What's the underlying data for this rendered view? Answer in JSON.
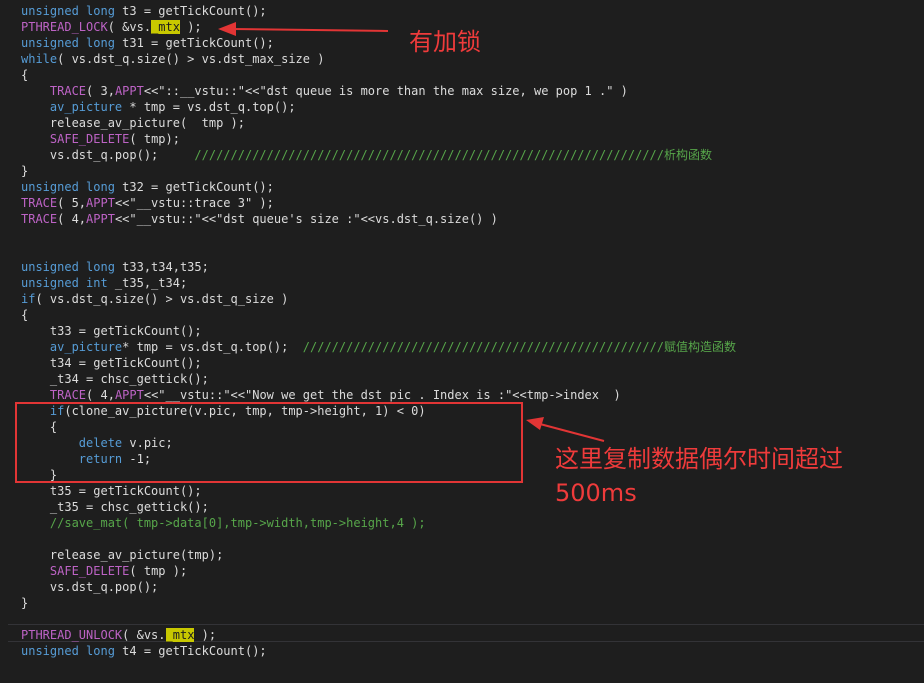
{
  "lines": [
    {
      "parts": [
        [
          "kw",
          "unsigned long"
        ],
        [
          "t",
          " t3 = getTickCount();"
        ]
      ]
    },
    {
      "parts": [
        [
          "mac",
          "PTHREAD_LOCK"
        ],
        [
          "t",
          "( &vs."
        ],
        [
          "hl",
          "_mtx"
        ],
        [
          "t",
          " );"
        ]
      ]
    },
    {
      "parts": [
        [
          "kw",
          "unsigned long"
        ],
        [
          "t",
          " t31 = getTickCount();"
        ]
      ]
    },
    {
      "parts": [
        [
          "kw",
          "while"
        ],
        [
          "t",
          "( vs.dst_q.size() > vs.dst_max_size )"
        ]
      ]
    },
    {
      "parts": [
        [
          "t",
          "{"
        ]
      ]
    },
    {
      "parts": [
        [
          "t",
          "    "
        ],
        [
          "mac",
          "TRACE"
        ],
        [
          "t",
          "( 3,"
        ],
        [
          "mac",
          "APPT"
        ],
        [
          "t",
          "<<\"::__vstu::\"<<\"dst queue is more than the max size, we pop 1 .\" )"
        ]
      ]
    },
    {
      "parts": [
        [
          "t",
          "    "
        ],
        [
          "kw",
          "av_picture"
        ],
        [
          "t",
          " * tmp = vs.dst_q.top();"
        ]
      ]
    },
    {
      "parts": [
        [
          "t",
          "    release_av_picture(  tmp );"
        ]
      ]
    },
    {
      "parts": [
        [
          "t",
          "    "
        ],
        [
          "mac",
          "SAFE_DELETE"
        ],
        [
          "t",
          "( tmp);"
        ]
      ]
    },
    {
      "parts": [
        [
          "t",
          "    vs.dst_q.pop();     "
        ],
        [
          "cm",
          "/////////////////////////////////////////////////////////////////析构函数"
        ]
      ]
    },
    {
      "parts": [
        [
          "t",
          "}"
        ]
      ]
    },
    {
      "parts": [
        [
          "kw",
          "unsigned long"
        ],
        [
          "t",
          " t32 = getTickCount();"
        ]
      ]
    },
    {
      "parts": [
        [
          "mac",
          "TRACE"
        ],
        [
          "t",
          "( 5,"
        ],
        [
          "mac",
          "APPT"
        ],
        [
          "t",
          "<<\"__vstu::trace 3\" );"
        ]
      ]
    },
    {
      "parts": [
        [
          "mac",
          "TRACE"
        ],
        [
          "t",
          "( 4,"
        ],
        [
          "mac",
          "APPT"
        ],
        [
          "t",
          "<<\"__vstu::\"<<\"dst queue's size :\"<<vs.dst_q.size() )"
        ]
      ]
    },
    {
      "parts": []
    },
    {
      "parts": []
    },
    {
      "parts": [
        [
          "kw",
          "unsigned long"
        ],
        [
          "t",
          " t33,t34,t35;"
        ]
      ]
    },
    {
      "parts": [
        [
          "kw",
          "unsigned int"
        ],
        [
          "t",
          " _t35,_t34;"
        ]
      ]
    },
    {
      "parts": [
        [
          "kw",
          "if"
        ],
        [
          "t",
          "( vs.dst_q.size() > vs.dst_q_size )"
        ]
      ]
    },
    {
      "parts": [
        [
          "t",
          "{"
        ]
      ]
    },
    {
      "parts": [
        [
          "t",
          "    t33 = getTickCount();"
        ]
      ]
    },
    {
      "parts": [
        [
          "t",
          "    "
        ],
        [
          "kw",
          "av_picture"
        ],
        [
          "t",
          "* tmp = vs.dst_q.top();  "
        ],
        [
          "cm",
          "//////////////////////////////////////////////////赋值构造函数"
        ]
      ]
    },
    {
      "parts": [
        [
          "t",
          "    t34 = getTickCount();"
        ]
      ]
    },
    {
      "parts": [
        [
          "t",
          "    _t34 = chsc_gettick();"
        ]
      ]
    },
    {
      "parts": [
        [
          "t",
          "    "
        ],
        [
          "mac",
          "TRACE"
        ],
        [
          "t",
          "( 4,"
        ],
        [
          "mac",
          "APPT"
        ],
        [
          "t",
          "<<\"__vstu::\"<<\"Now we get the dst pic . Index is :\"<<tmp->index  )"
        ]
      ]
    },
    {
      "parts": [
        [
          "t",
          "    "
        ],
        [
          "kw",
          "if"
        ],
        [
          "t",
          "(clone_av_picture(v.pic, tmp, tmp->height, 1) < 0)"
        ]
      ]
    },
    {
      "parts": [
        [
          "t",
          "    {"
        ]
      ]
    },
    {
      "parts": [
        [
          "t",
          "        "
        ],
        [
          "kw",
          "delete"
        ],
        [
          "t",
          " v.pic;"
        ]
      ]
    },
    {
      "parts": [
        [
          "t",
          "        "
        ],
        [
          "kw",
          "return"
        ],
        [
          "t",
          " -1;"
        ]
      ]
    },
    {
      "parts": [
        [
          "t",
          "    }"
        ]
      ]
    },
    {
      "parts": [
        [
          "t",
          "    t35 = getTickCount();"
        ]
      ]
    },
    {
      "parts": [
        [
          "t",
          "    _t35 = chsc_gettick();"
        ]
      ]
    },
    {
      "parts": [
        [
          "t",
          "    "
        ],
        [
          "cm",
          "//save_mat( tmp->data[0],tmp->width,tmp->height,4 );"
        ]
      ]
    },
    {
      "parts": []
    },
    {
      "parts": [
        [
          "t",
          "    release_av_picture(tmp);"
        ]
      ]
    },
    {
      "parts": [
        [
          "t",
          "    "
        ],
        [
          "mac",
          "SAFE_DELETE"
        ],
        [
          "t",
          "( tmp );"
        ]
      ]
    },
    {
      "parts": [
        [
          "t",
          "    vs.dst_q.pop();"
        ]
      ]
    },
    {
      "parts": [
        [
          "t",
          "}"
        ]
      ]
    },
    {
      "parts": []
    },
    {
      "parts": [
        [
          "mac",
          "PTHREAD_UNLOCK"
        ],
        [
          "t",
          "( &vs."
        ],
        [
          "hl",
          "_mtx"
        ],
        [
          "t",
          " );"
        ]
      ]
    },
    {
      "parts": [
        [
          "kw",
          "unsigned long"
        ],
        [
          "t",
          " t4 = getTickCount();"
        ]
      ]
    }
  ],
  "annotations": {
    "lock_note": "有加锁",
    "copy_note_line1": "这里复制数据偶尔时间超过",
    "copy_note_line2": "500ms"
  },
  "colors": {
    "keyword": "#569cd6",
    "macro": "#bd63c5",
    "string": "#d69d85",
    "comment": "#57a64a",
    "highlight": "#c8c800",
    "annotation": "#ef3b3b"
  }
}
